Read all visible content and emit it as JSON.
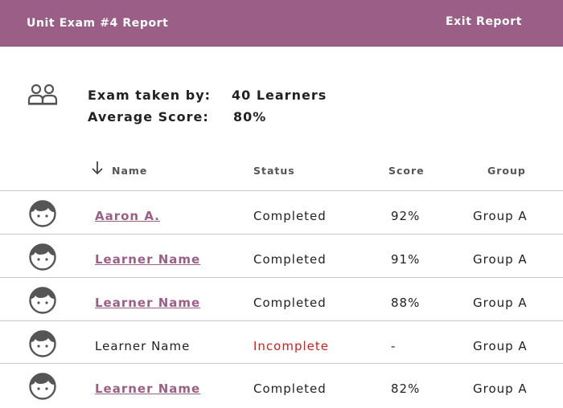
{
  "header": {
    "title": "Unit Exam #4 Report",
    "exit_label": "Exit Report",
    "background_color": "#9b5f87"
  },
  "summary": {
    "icon": "group-icon",
    "taken_label": "Exam taken by:",
    "taken_value": "40 Learners",
    "average_label": "Average Score:",
    "average_value": "80%"
  },
  "table": {
    "sort_icon": "arrow-down-icon",
    "columns": [
      "Name",
      "Status",
      "Score",
      "Group"
    ],
    "rows": [
      {
        "name": "Aaron A.",
        "status": "Completed",
        "score": "92%",
        "group": "Group A",
        "linked": true
      },
      {
        "name": "Learner Name",
        "status": "Completed",
        "score": "91%",
        "group": "Group A",
        "linked": true
      },
      {
        "name": "Learner Name",
        "status": "Completed",
        "score": "88%",
        "group": "Group A",
        "linked": true
      },
      {
        "name": "Learner Name",
        "status": "Incomplete",
        "score": "-",
        "group": "Group A",
        "linked": false
      },
      {
        "name": "Learner Name",
        "status": "Completed",
        "score": "82%",
        "group": "Group A",
        "linked": true
      }
    ]
  },
  "colors": {
    "accent": "#9b5f87",
    "incomplete": "#d21f1f"
  }
}
